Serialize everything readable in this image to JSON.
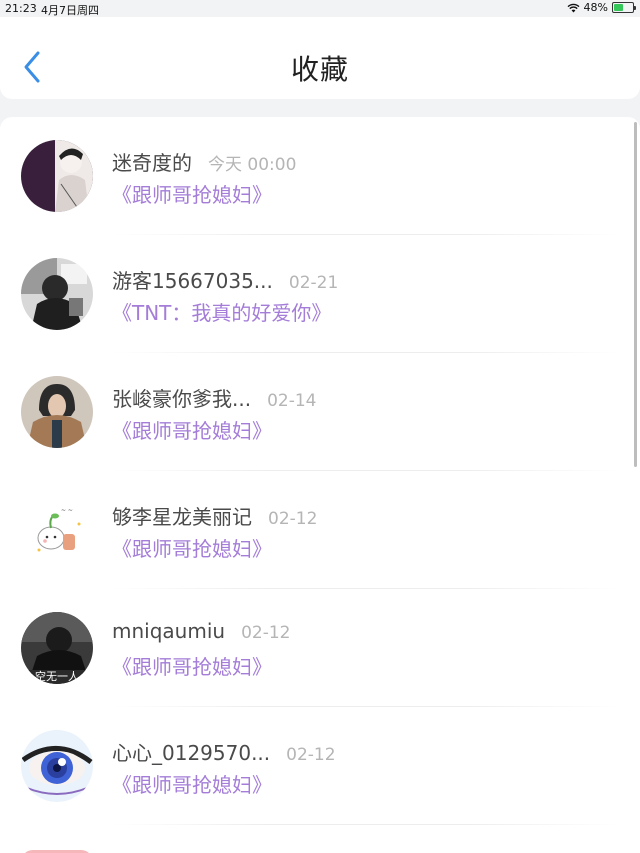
{
  "status_bar": {
    "time": "21:23",
    "date": "4月7日周四",
    "battery": "48%",
    "battery_level": 0.48
  },
  "header": {
    "title": "收藏"
  },
  "colors": {
    "accent": "#3a8ee6",
    "book_title": "#a47dd8",
    "name_text": "#4a4a4a",
    "date_text": "#b5b5b5"
  },
  "items": [
    {
      "name": "迷奇度的",
      "date": "今天 00:00",
      "book": "《跟师哥抢媳妇》",
      "avatar": "avatar-anime-boy"
    },
    {
      "name": "游客15667035...",
      "date": "02-21",
      "book": "《TNT：我真的好爱你》",
      "avatar": "avatar-bw-photo"
    },
    {
      "name": "张峻豪你爹我...",
      "date": "02-14",
      "book": "《跟师哥抢媳妇》",
      "avatar": "avatar-hoodie-person"
    },
    {
      "name": "够李星龙美丽记",
      "date": "02-12",
      "book": "《跟师哥抢媳妇》",
      "avatar": "avatar-cartoon-sticker"
    },
    {
      "name": "mniqaumiu",
      "date": "02-12",
      "book": "《跟师哥抢媳妇》",
      "avatar": "avatar-dark-figure",
      "avatar_text": "空无一人"
    },
    {
      "name": "心心_0129570...",
      "date": "02-12",
      "book": "《跟师哥抢媳妇》",
      "avatar": "avatar-anime-eye"
    }
  ]
}
